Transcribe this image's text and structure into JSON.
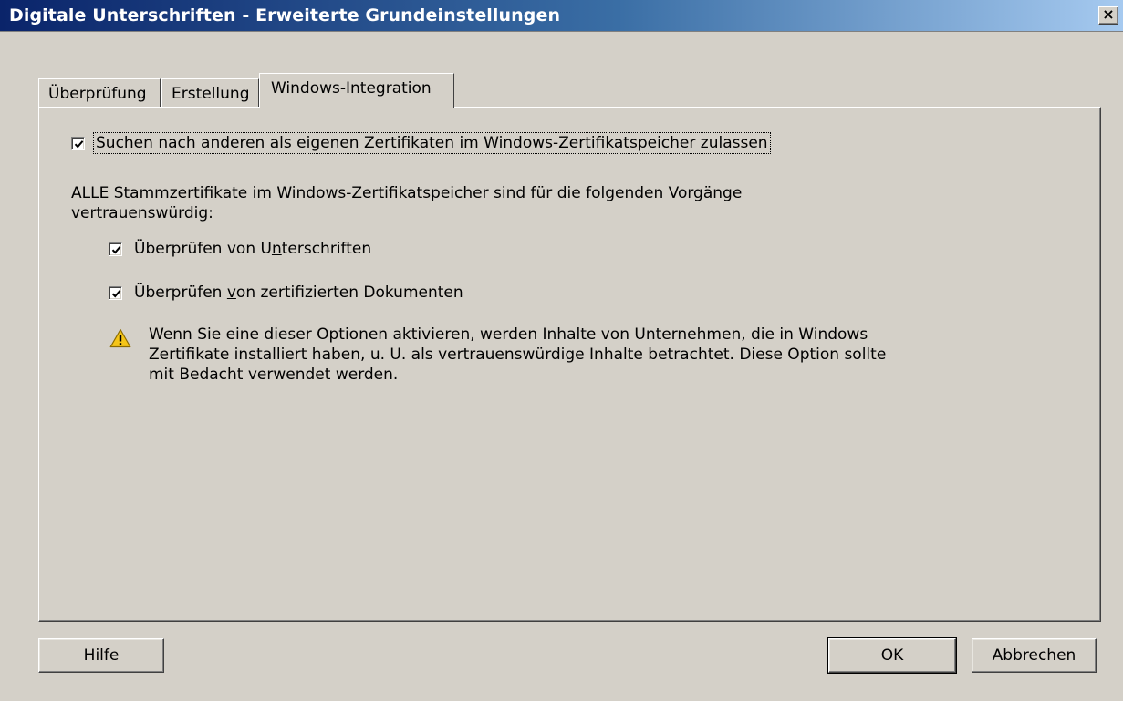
{
  "window": {
    "title": "Digitale Unterschriften - Erweiterte Grundeinstellungen",
    "close_glyph": "×"
  },
  "tabs": [
    {
      "label": "Überprüfung",
      "selected": false
    },
    {
      "label": "Erstellung",
      "selected": false
    },
    {
      "label": "Windows-Integration",
      "selected": true
    }
  ],
  "options": {
    "search_others": {
      "checked": true,
      "label_pre": "Suchen nach anderen als eigenen Zertifikaten im ",
      "label_accel": "W",
      "label_post": "indows-Zertifikatspeicher zulassen"
    },
    "trust_description": "ALLE Stammzertifikate im Windows-Zertifikatspeicher sind für die folgenden Vorgänge vertrauenswürdig:",
    "verify_signatures": {
      "checked": true,
      "label_pre": "Überprüfen von U",
      "label_accel": "n",
      "label_post": "terschriften"
    },
    "verify_certified": {
      "checked": true,
      "label_pre": "Überprüfen ",
      "label_accel": "v",
      "label_post": "on zertifizierten Dokumenten"
    }
  },
  "warning": {
    "icon": "warning-triangle-icon",
    "text": "Wenn Sie eine dieser Optionen aktivieren, werden Inhalte von Unternehmen, die in Windows Zertifikate installiert haben, u. U. als vertrauenswürdige Inhalte betrachtet. Diese Option sollte mit Bedacht verwendet werden."
  },
  "buttons": {
    "help": "Hilfe",
    "ok": "OK",
    "cancel": "Abbrechen"
  }
}
